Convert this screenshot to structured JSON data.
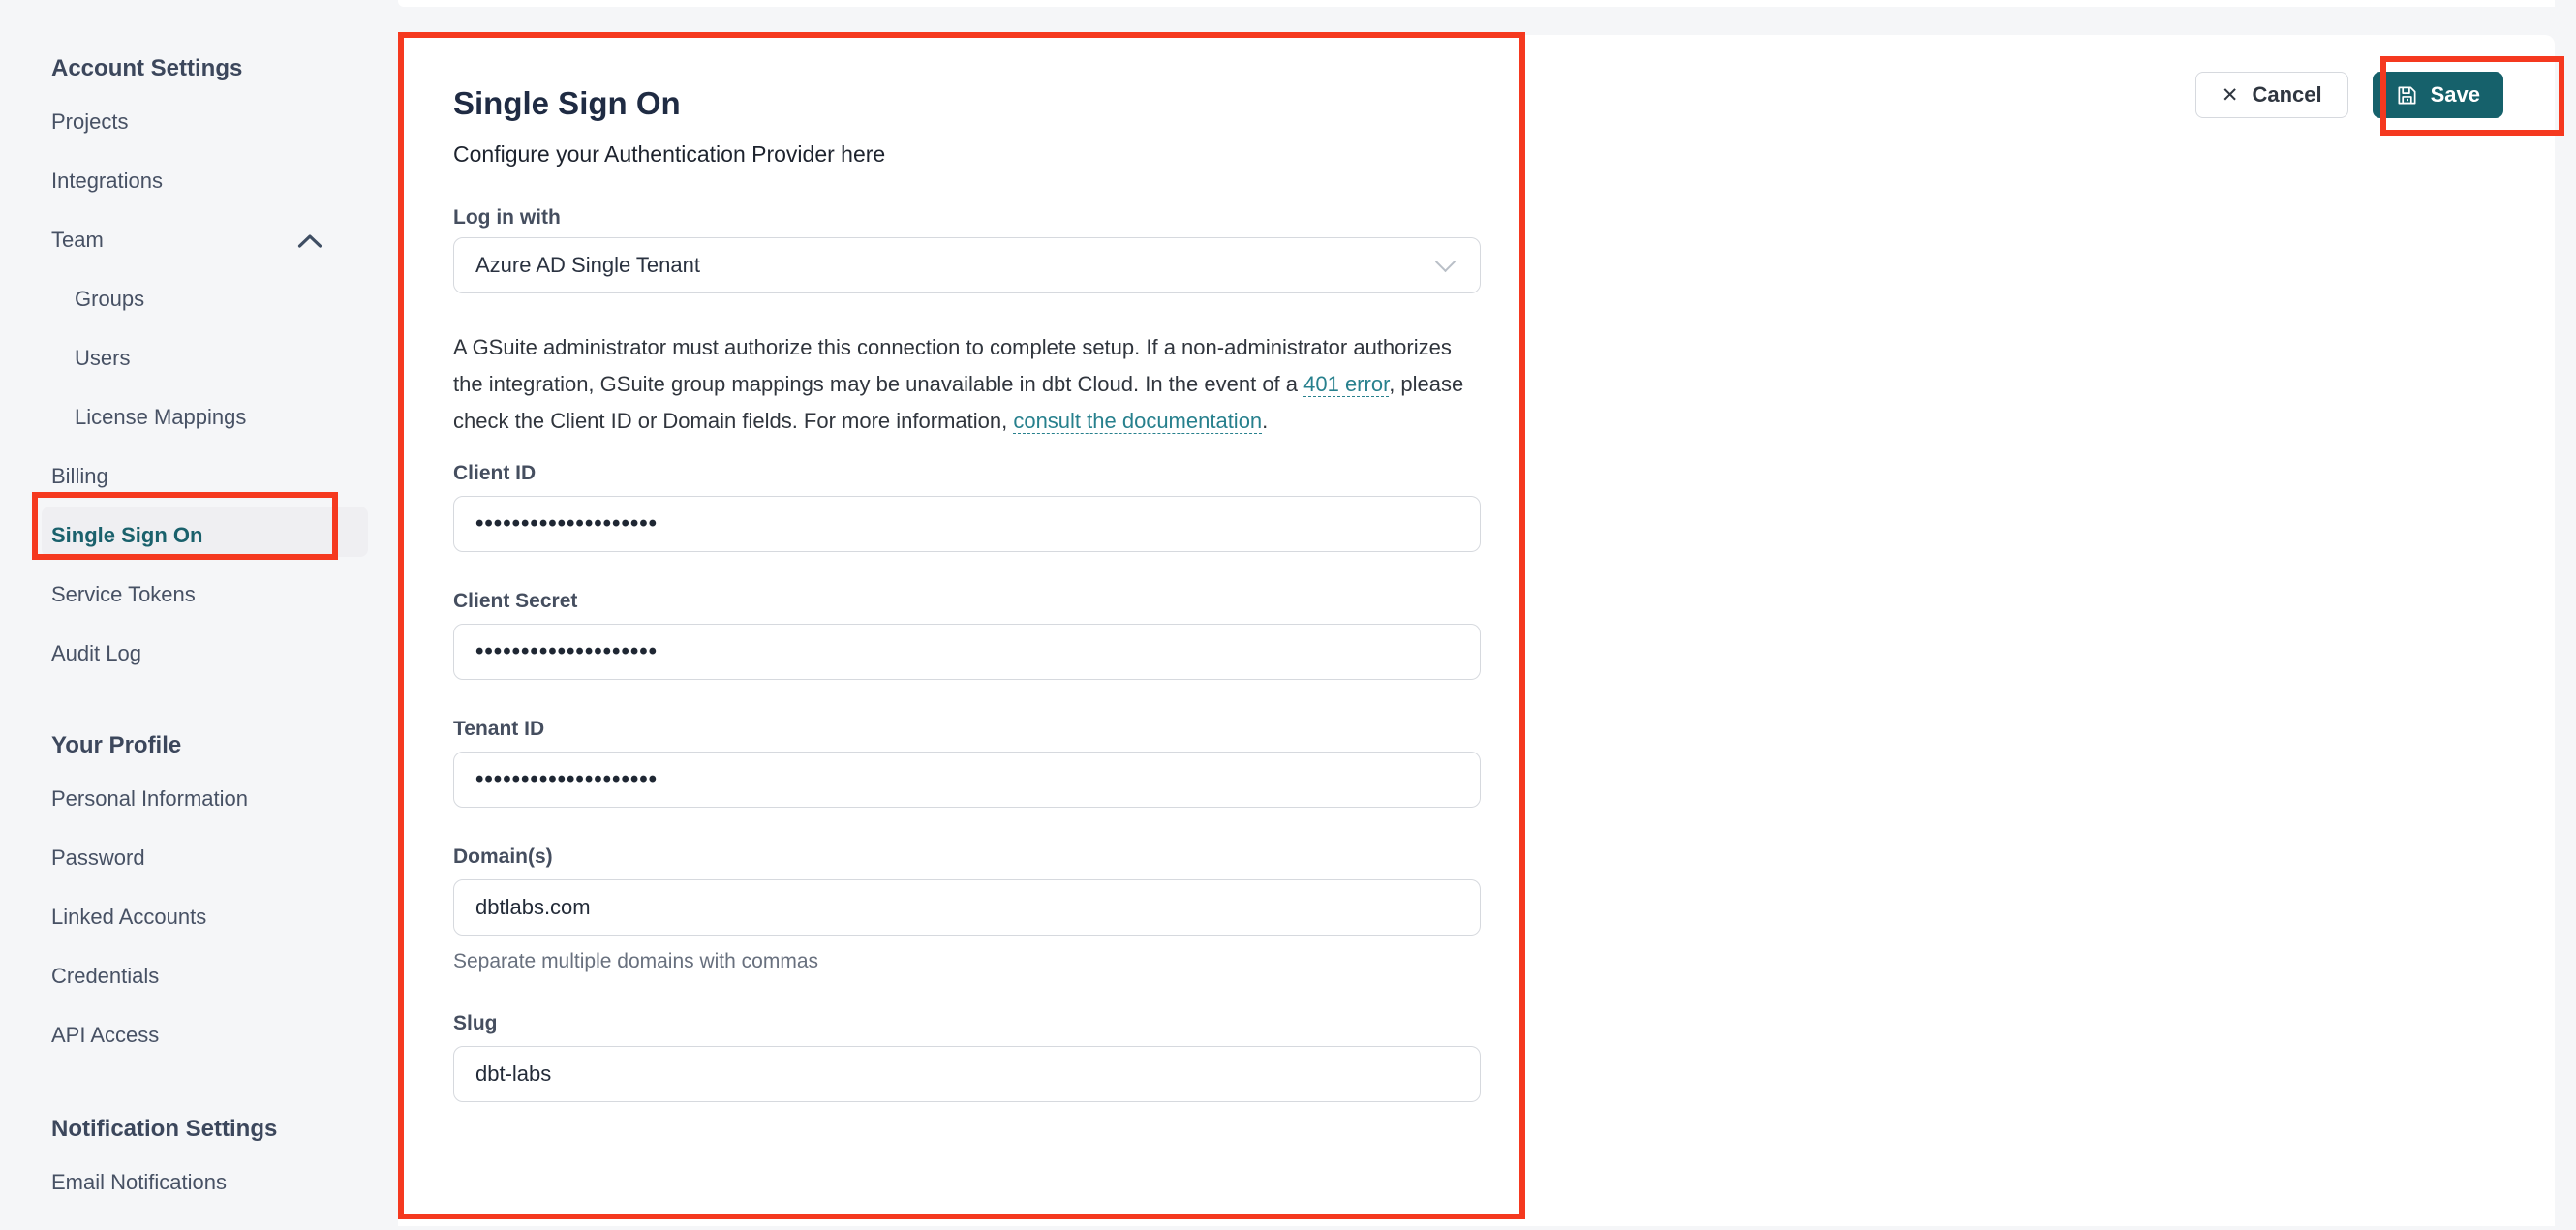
{
  "colors": {
    "annotation_red": "#f5391f",
    "accent_teal": "#16616b",
    "link_teal": "#27808d",
    "page_background": "#f5f6f8"
  },
  "icons": {
    "cancel_x": "✕"
  },
  "sidebar": {
    "sections": [
      {
        "heading": "Account Settings",
        "items": [
          {
            "label": "Projects"
          },
          {
            "label": "Integrations"
          },
          {
            "label": "Team",
            "expanded": true
          },
          {
            "label": "Groups",
            "indent": true
          },
          {
            "label": "Users",
            "indent": true
          },
          {
            "label": "License Mappings",
            "indent": true
          },
          {
            "label": "Billing"
          },
          {
            "label": "Single Sign On",
            "active": true
          },
          {
            "label": "Service Tokens"
          },
          {
            "label": "Audit Log"
          }
        ]
      },
      {
        "heading": "Your Profile",
        "items": [
          {
            "label": "Personal Information"
          },
          {
            "label": "Password"
          },
          {
            "label": "Linked Accounts"
          },
          {
            "label": "Credentials"
          },
          {
            "label": "API Access"
          }
        ]
      },
      {
        "heading": "Notification Settings",
        "items": [
          {
            "label": "Email Notifications"
          }
        ]
      }
    ]
  },
  "main": {
    "title": "Single Sign On",
    "subtitle": "Configure your Authentication Provider here",
    "login_with": {
      "label": "Log in with",
      "value": "Azure AD Single Tenant"
    },
    "notice": {
      "text_1": "A GSuite administrator must authorize this connection to complete setup. If a non-administrator authorizes the integration, GSuite group mappings may be unavailable in dbt Cloud. In the event of a ",
      "link_401": "401 error",
      "text_2": ", please check the Client ID or Domain fields. For more information, ",
      "link_docs": "consult the documentation",
      "text_3": "."
    },
    "fields": [
      {
        "label": "Client ID",
        "value": "••••••••••••••••••••"
      },
      {
        "label": "Client Secret",
        "value": "••••••••••••••••••••"
      },
      {
        "label": "Tenant ID",
        "value": "••••••••••••••••••••"
      },
      {
        "label": "Domain(s)",
        "value": "dbtlabs.com",
        "helper": "Separate multiple domains with commas"
      },
      {
        "label": "Slug",
        "value": "dbt-labs"
      }
    ],
    "actions": {
      "cancel": "Cancel",
      "save": "Save"
    }
  }
}
